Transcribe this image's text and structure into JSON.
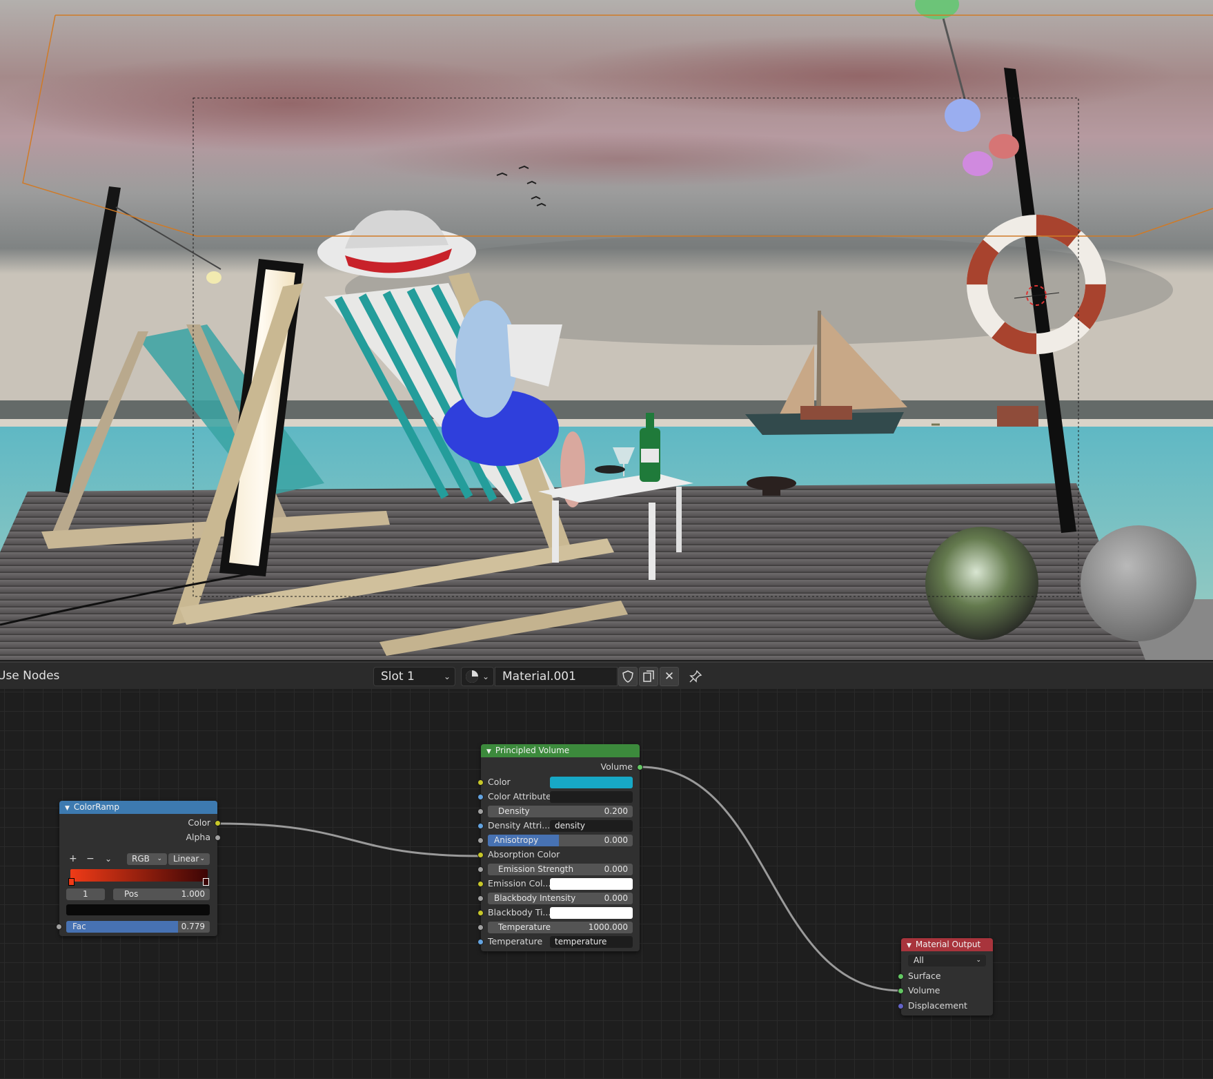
{
  "header": {
    "use_nodes_label": "Use Nodes",
    "slot_label": "Slot 1",
    "material_name": "Material.001"
  },
  "nodes": {
    "colorramp": {
      "title": "ColorRamp",
      "out_color": "Color",
      "out_alpha": "Alpha",
      "add": "+",
      "remove": "−",
      "menu": "⌄",
      "color_mode": "RGB",
      "interpolation": "Linear",
      "stop_index": "1",
      "pos_label": "Pos",
      "pos_value": "1.000",
      "fac_label": "Fac",
      "fac_value": "0.779",
      "fac_fraction": 0.779,
      "ramp_colors": [
        "#f03b17",
        "#3c0505"
      ]
    },
    "principled_volume": {
      "title": "Principled Volume",
      "out_volume": "Volume",
      "color_label": "Color",
      "color_value": "#17a8c6",
      "color_attr_label": "Color Attribute",
      "density_label": "Density",
      "density_value": "0.200",
      "density_attr_label": "Density Attri...",
      "density_attr_value": "density",
      "anisotropy_label": "Anisotropy",
      "anisotropy_value": "0.000",
      "absorption_label": "Absorption Color",
      "emission_strength_label": "Emission Strength",
      "emission_strength_value": "0.000",
      "emission_color_label": "Emission Col...",
      "blackbody_intensity_label": "Blackbody Intensity",
      "blackbody_intensity_value": "0.000",
      "blackbody_tint_label": "Blackbody Ti...",
      "temperature_label": "Temperature",
      "temperature_value": "1000.000",
      "temperature_attr_label": "Temperature",
      "temperature_attr_value": "temperature"
    },
    "material_output": {
      "title": "Material Output",
      "target": "All",
      "surface": "Surface",
      "volume": "Volume",
      "displacement": "Displacement"
    }
  },
  "colors": {
    "colorramp_header": "#3d7ab0",
    "volume_header": "#3c8a3c",
    "output_header": "#a8343c",
    "link": "#9a9a9a"
  }
}
